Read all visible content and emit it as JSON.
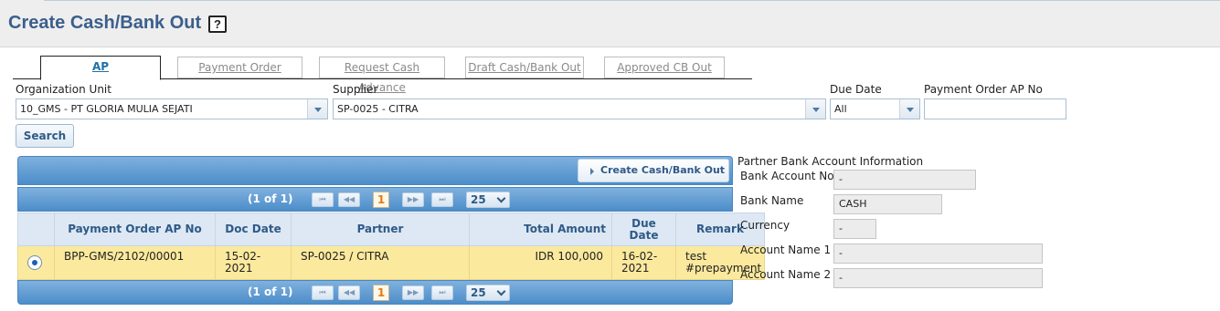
{
  "page": {
    "title": "Create Cash/Bank Out",
    "help_label": "?"
  },
  "tabs": [
    {
      "label": "AP",
      "active": true
    },
    {
      "label": "Payment Order",
      "active": false
    },
    {
      "label": "Request Cash Advance",
      "active": false
    },
    {
      "label": "Draft Cash/Bank Out",
      "active": false
    },
    {
      "label": "Approved CB Out",
      "active": false
    }
  ],
  "filters": {
    "org_unit_label": "Organization Unit",
    "org_unit_value": "10_GMS - PT GLORIA MULIA SEJATI",
    "supplier_label": "Supplier",
    "supplier_value": "SP-0025 - CITRA",
    "due_date_label": "Due Date",
    "due_date_value": "All",
    "payment_order_label": "Payment Order AP No",
    "payment_order_value": "",
    "search_label": "Search"
  },
  "grid": {
    "create_button_label": "Create Cash/Bank Out",
    "pager_info": "(1 of 1)",
    "current_page": "1",
    "page_size": "25",
    "pager_icons": {
      "first": "⏮",
      "prev": "◀◀",
      "next": "▶▶",
      "last": "⏭"
    },
    "columns": [
      "Payment Order AP No",
      "Doc Date",
      "Partner",
      "Total Amount",
      "Due Date",
      "Remark"
    ],
    "rows": [
      {
        "selected": true,
        "payment_order_no": "BPP-GMS/2102/00001",
        "doc_date": "15-02-2021",
        "partner": "SP-0025 / CITRA",
        "total_amount": "IDR 100,000",
        "due_date": "16-02-2021",
        "remark": "test #prepayment"
      }
    ]
  },
  "bank_info": {
    "title": "Partner Bank Account Information",
    "bank_account_no_label": "Bank Account No",
    "bank_account_no_value": "-",
    "bank_name_label": "Bank Name",
    "bank_name_value": "CASH",
    "currency_label": "Currency",
    "currency_value": "-",
    "account_name_1_label": "Account Name 1",
    "account_name_1_value": "-",
    "account_name_2_label": "Account Name 2",
    "account_name_2_value": "-"
  },
  "colors": {
    "title": "#3a5f8c",
    "grid_header": "#4c8dc9",
    "selected_row": "#fbe99d",
    "active_tab": "#1f6fa8"
  }
}
